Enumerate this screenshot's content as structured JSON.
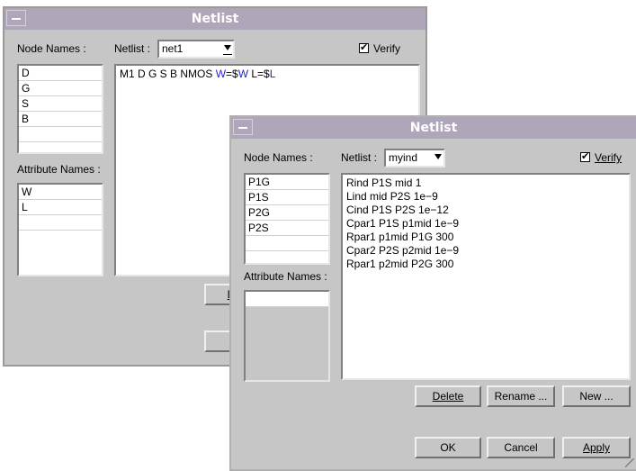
{
  "back_window": {
    "title": "Netlist",
    "node_names_label": "Node Names :",
    "node_names": [
      "D",
      "G",
      "S",
      "B"
    ],
    "netlist_label": "Netlist :",
    "netlist_value": "net1",
    "verify_label": "Verify",
    "attribute_names_label": "Attribute Names :",
    "attribute_names": [
      "W",
      "L"
    ],
    "netlist_text": {
      "part1": "M1 D G S B NMOS ",
      "part2": "W",
      "part3": "=$",
      "part4": "W",
      "part5": " L=$",
      "part6": "L"
    },
    "partial_button": "D"
  },
  "front_window": {
    "title": "Netlist",
    "node_names_label": "Node Names :",
    "node_names": [
      "P1G",
      "P1S",
      "P2G",
      "P2S"
    ],
    "netlist_label": "Netlist :",
    "netlist_value": "myind",
    "verify_label": "Verify",
    "attribute_names_label": "Attribute Names :",
    "netlist_lines": [
      "Rind P1S mid 1",
      "Lind mid P2S 1e−9",
      "Cind P1S P2S 1e−12",
      "Cpar1 P1S p1mid 1e−9",
      "Rpar1 p1mid P1G 300",
      "Cpar2 P2S p2mid 1e−9",
      "Rpar1 p2mid P2G 300"
    ],
    "buttons": {
      "delete": "Delete",
      "rename": "Rename ...",
      "new": "New ...",
      "ok": "OK",
      "cancel": "Cancel",
      "apply": "Apply"
    }
  },
  "colors": {
    "title_bar": "#b0a6ba",
    "window_bg": "#c6c6c6",
    "highlight": "#2323d8"
  }
}
